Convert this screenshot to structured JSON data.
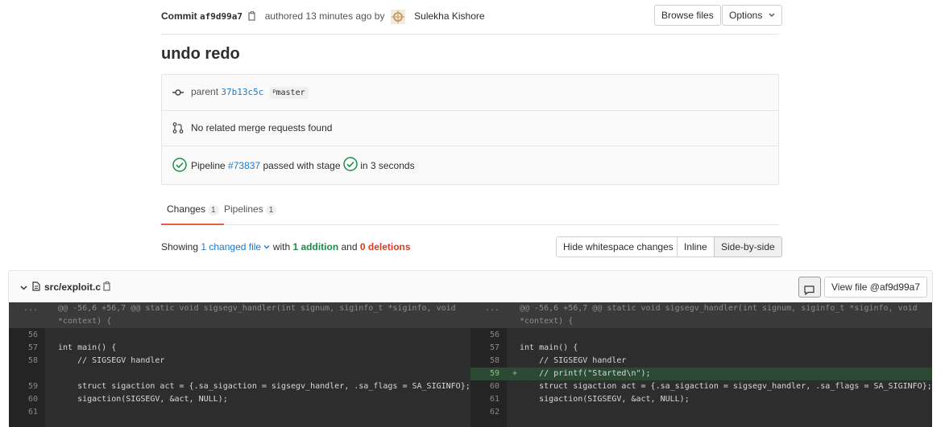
{
  "commit": {
    "label": "Commit",
    "sha": "af9d99a7",
    "authored": "authored 13 minutes ago by",
    "author": "Sulekha Kishore",
    "browse_files": "Browse files",
    "options": "Options",
    "title": "undo redo"
  },
  "info": {
    "parent_label": "parent",
    "parent_sha": "37b13c5c",
    "branch": "master",
    "merge_requests": "No related merge requests found",
    "pipeline_label": "Pipeline",
    "pipeline_id": "#73837",
    "pipeline_status": "passed with stage",
    "pipeline_duration": "in 3 seconds"
  },
  "tabs": [
    {
      "label": "Changes",
      "count": "1"
    },
    {
      "label": "Pipelines",
      "count": "1"
    }
  ],
  "summary": {
    "showing": "Showing",
    "changed_file": "1 changed file",
    "with": "with",
    "additions": "1 addition",
    "and": "and",
    "deletions": "0 deletions",
    "hide_whitespace": "Hide whitespace changes",
    "inline": "Inline",
    "side_by_side": "Side-by-side"
  },
  "file": {
    "path": "src/exploit.c",
    "view_file": "View file @af9d99a7"
  },
  "diff": {
    "hunk_line1": "@@ -56,6 +56,7 @@ static void sigsegv_handler(int signum, siginfo_t *siginfo, void",
    "hunk_line2": "*context) {",
    "hunk_num": "...",
    "left": [
      {
        "num": "56",
        "code": "",
        "type": "context"
      },
      {
        "num": "57",
        "code": "int main() {",
        "type": "context"
      },
      {
        "num": "58",
        "code": "    // SIGSEGV handler",
        "type": "context"
      },
      {
        "num": "",
        "code": "",
        "type": "empty"
      },
      {
        "num": "59",
        "code": "    struct sigaction act = {.sa_sigaction = sigsegv_handler, .sa_flags = SA_SIGINFO};",
        "type": "context"
      },
      {
        "num": "60",
        "code": "    sigaction(SIGSEGV, &act, NULL);",
        "type": "context"
      },
      {
        "num": "61",
        "code": "",
        "type": "context"
      }
    ],
    "right": [
      {
        "num": "56",
        "code": "",
        "type": "context"
      },
      {
        "num": "57",
        "code": "int main() {",
        "type": "context"
      },
      {
        "num": "58",
        "code": "    // SIGSEGV handler",
        "type": "context"
      },
      {
        "num": "59",
        "code": "    // printf(\"Started\\n\");",
        "type": "added"
      },
      {
        "num": "60",
        "code": "    struct sigaction act = {.sa_sigaction = sigsegv_handler, .sa_flags = SA_SIGINFO};",
        "type": "context"
      },
      {
        "num": "61",
        "code": "    sigaction(SIGSEGV, &act, NULL);",
        "type": "context"
      },
      {
        "num": "62",
        "code": "",
        "type": "context"
      }
    ]
  }
}
